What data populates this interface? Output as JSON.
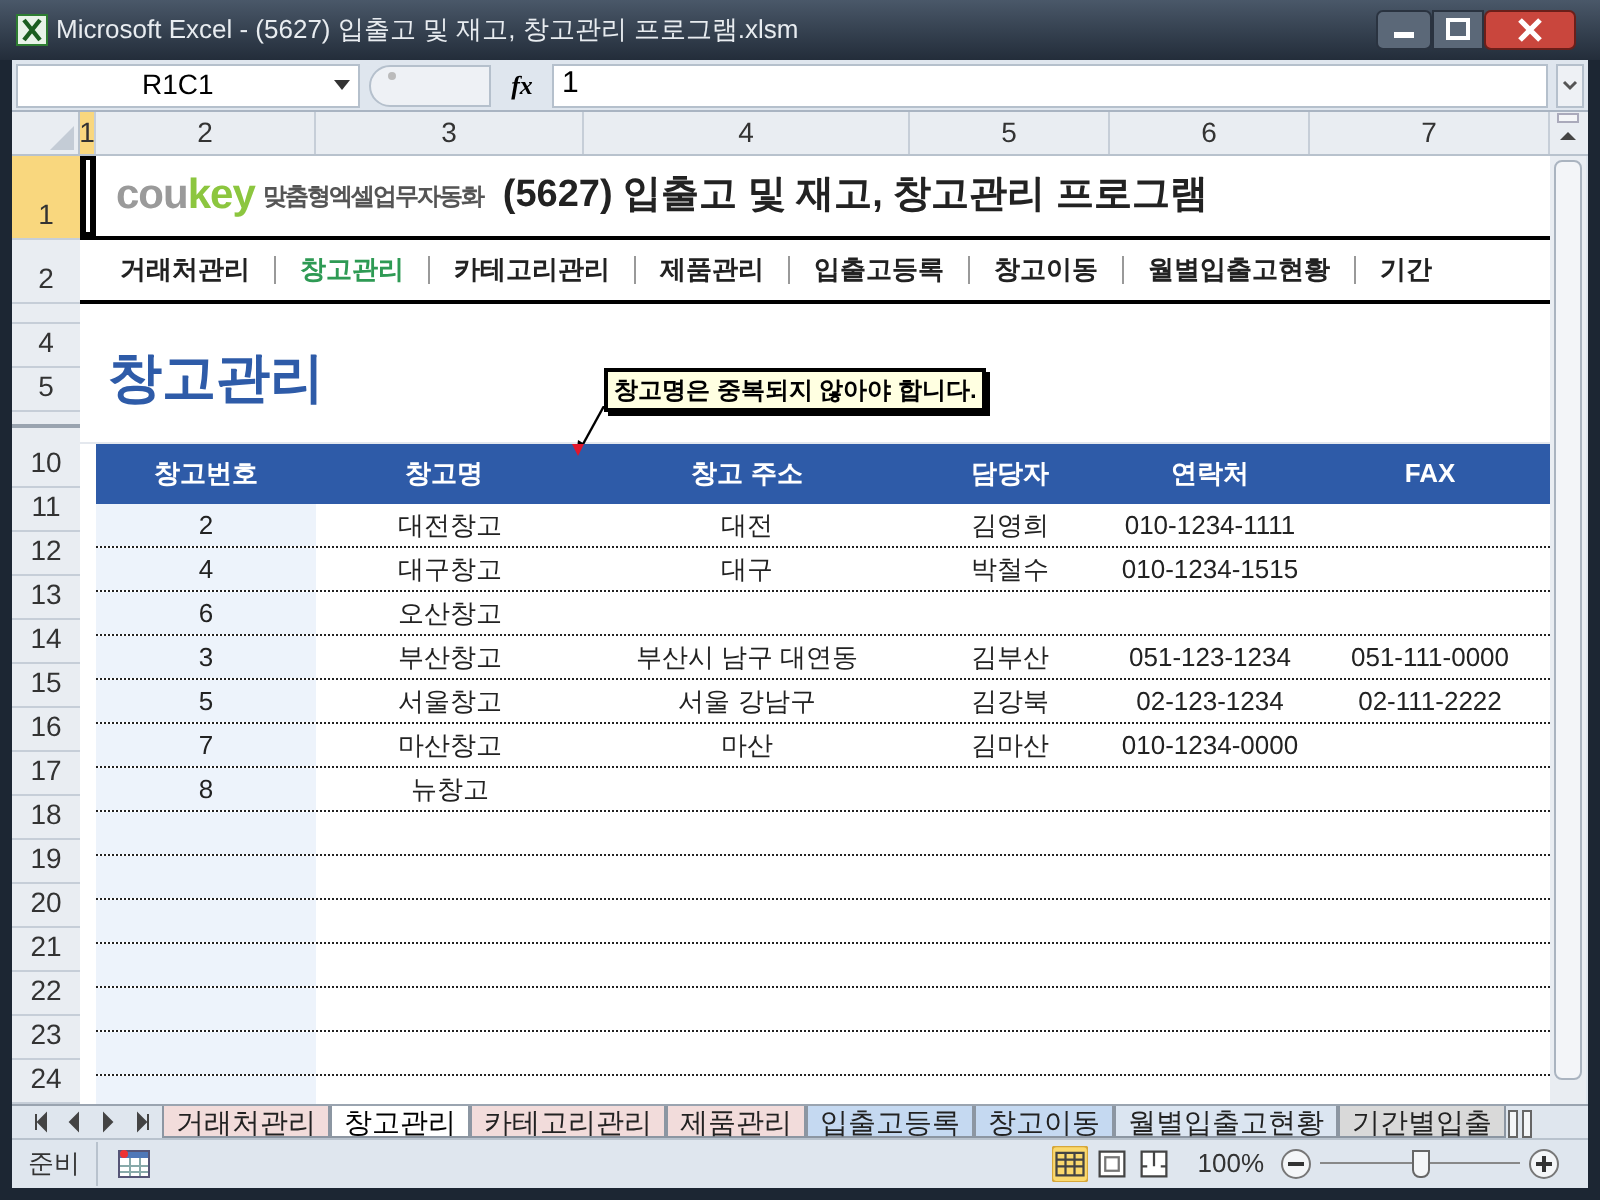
{
  "window": {
    "title": "Microsoft Excel - (5627) 입출고 및 재고, 창고관리 프로그램.xlsm"
  },
  "formula_bar": {
    "name_box": "R1C1",
    "fx": "fx",
    "formula": "1"
  },
  "column_headers": [
    {
      "label": "1",
      "selected": true
    },
    {
      "label": "2",
      "selected": false
    },
    {
      "label": "3",
      "selected": false
    },
    {
      "label": "4",
      "selected": false
    },
    {
      "label": "5",
      "selected": false
    },
    {
      "label": "6",
      "selected": false
    },
    {
      "label": "7",
      "selected": false
    }
  ],
  "row_headers": [
    {
      "label": "1",
      "selected": true
    },
    {
      "label": "2",
      "selected": false
    },
    {
      "label": "4",
      "selected": false
    },
    {
      "label": "5",
      "selected": false
    },
    {
      "label": "10",
      "selected": false
    },
    {
      "label": "11",
      "selected": false
    },
    {
      "label": "12",
      "selected": false
    },
    {
      "label": "13",
      "selected": false
    },
    {
      "label": "14",
      "selected": false
    },
    {
      "label": "15",
      "selected": false
    },
    {
      "label": "16",
      "selected": false
    },
    {
      "label": "17",
      "selected": false
    },
    {
      "label": "18",
      "selected": false
    },
    {
      "label": "19",
      "selected": false
    },
    {
      "label": "20",
      "selected": false
    },
    {
      "label": "21",
      "selected": false
    },
    {
      "label": "22",
      "selected": false
    },
    {
      "label": "23",
      "selected": false
    },
    {
      "label": "24",
      "selected": false
    }
  ],
  "header": {
    "brand": [
      "cou",
      "key"
    ],
    "tagline": "맞춤형엑셀업무자동화",
    "title": "(5627) 입출고 및 재고, 창고관리 프로그램"
  },
  "nav": [
    {
      "label": "거래처관리",
      "selected": false
    },
    {
      "label": "창고관리",
      "selected": true
    },
    {
      "label": "카테고리관리",
      "selected": false
    },
    {
      "label": "제품관리",
      "selected": false
    },
    {
      "label": "입출고등록",
      "selected": false
    },
    {
      "label": "창고이동",
      "selected": false
    },
    {
      "label": "월별입출고현황",
      "selected": false
    },
    {
      "label": "기간",
      "selected": false
    }
  ],
  "page_title": "창고관리",
  "note": "창고명은 중복되지 않아야 합니다.",
  "table": {
    "columns": [
      "창고번호",
      "창고명",
      "창고 주소",
      "담당자",
      "연락처",
      "FAX"
    ],
    "rows": [
      {
        "no": "2",
        "name": "대전창고",
        "address": "대전",
        "manager": "김영희",
        "phone": "010-1234-1111"
      },
      {
        "no": "4",
        "name": "대구창고",
        "address": "대구",
        "manager": "박철수",
        "phone": "010-1234-1515"
      },
      {
        "no": "6",
        "name": "오산창고"
      },
      {
        "no": "3",
        "name": "부산창고",
        "address": "부산시 남구 대연동",
        "manager": "김부산",
        "phone": "051-123-1234",
        "fax": "051-111-0000"
      },
      {
        "no": "5",
        "name": "서울창고",
        "address": "서울 강남구",
        "manager": "김강북",
        "phone": "02-123-1234",
        "fax": "02-111-2222"
      },
      {
        "no": "7",
        "name": "마산창고",
        "address": "마산",
        "manager": "김마산",
        "phone": "010-1234-0000"
      },
      {
        "no": "8",
        "name": "뉴창고"
      }
    ]
  },
  "sheet_tabs": [
    {
      "label": "거래처관리",
      "selected": false,
      "color": "#f2dcdb"
    },
    {
      "label": "창고관리",
      "selected": true
    },
    {
      "label": "카테고리관리",
      "selected": false,
      "color": "#f2dcdb"
    },
    {
      "label": "제품관리",
      "selected": false,
      "color": "#f2dcdb"
    },
    {
      "label": "입출고등록",
      "selected": false,
      "color": "#c5d9f1"
    },
    {
      "label": "창고이동",
      "selected": false,
      "color": "#c5d9f1"
    },
    {
      "label": "월별입출고현황",
      "selected": false,
      "color": "#dbe5f1"
    },
    {
      "label": "기간별입출",
      "selected": false,
      "color": "#d9d9d9"
    }
  ],
  "status_bar": {
    "mode": "준비",
    "views": [
      {
        "kind": "normal",
        "selected": true
      },
      {
        "kind": "layout",
        "selected": false
      },
      {
        "kind": "pagebreak",
        "selected": false
      }
    ],
    "zoom": "100%",
    "zoom_slider": {
      "level": 0.5
    }
  }
}
